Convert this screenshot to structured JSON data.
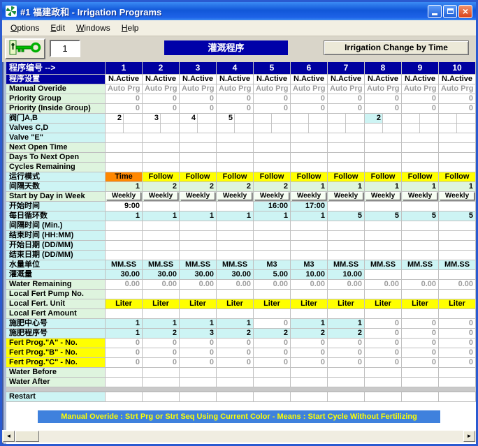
{
  "window": {
    "title": "#1 福建政和 - Irrigation Programs"
  },
  "menu": {
    "items": [
      "Options",
      "Edit",
      "Windows",
      "Help"
    ]
  },
  "toolbar": {
    "program_number": "1",
    "banner": "灌溉程序",
    "change_by_time_button": "Irrigation Change by Time"
  },
  "table": {
    "header_label": "程序编号 -->",
    "columns": [
      "1",
      "2",
      "3",
      "4",
      "5",
      "6",
      "7",
      "8",
      "9",
      "10"
    ],
    "rows": [
      {
        "name": "program-settings",
        "label": "程序设置",
        "label_bg": "navy",
        "values": "N.Active",
        "align": "center"
      },
      {
        "name": "manual-override",
        "label": "Manual Overide",
        "label_bg": "green",
        "values": "Auto Prg",
        "cell_fg": "gray",
        "align": "center"
      },
      {
        "name": "priority-group",
        "label": "Priority Group",
        "label_bg": "green",
        "values": "0",
        "cell_fg": "gray"
      },
      {
        "name": "priority-inside-group",
        "label": "Priority (Inside Group)",
        "label_bg": "green",
        "values": "0",
        "cell_fg": "gray"
      },
      {
        "name": "valves-a-b",
        "label": "阀门A,B",
        "label_bg": "cyan",
        "split": true,
        "values": [
          "2",
          "3",
          "4",
          "5",
          "",
          "",
          "",
          "2",
          "",
          ""
        ],
        "cell_bgs": [
          "white",
          "white",
          "white",
          "white",
          "white",
          "white",
          "white",
          "cyan",
          "white",
          "white"
        ]
      },
      {
        "name": "valves-c-d",
        "label": "Valves C,D",
        "label_bg": "cyan",
        "split": true,
        "values": ""
      },
      {
        "name": "valve-e",
        "label": "Valve \"E\"",
        "label_bg": "cyan",
        "values": ""
      },
      {
        "name": "next-open-time",
        "label": "Next  Open Time",
        "label_bg": "green",
        "values": ""
      },
      {
        "name": "days-to-next-open",
        "label": "Days To Next Open",
        "label_bg": "green",
        "values": ""
      },
      {
        "name": "cycles-remaining",
        "label": "Cycles Remaining",
        "label_bg": "green",
        "values": ""
      },
      {
        "name": "run-mode",
        "label": "运行模式",
        "label_bg": "cyan",
        "values": [
          "Time",
          "Follow",
          "Follow",
          "Follow",
          "Follow",
          "Follow",
          "Follow",
          "Follow",
          "Follow",
          "Follow"
        ],
        "cell_bgs": [
          "orange",
          "yellow",
          "yellow",
          "yellow",
          "yellow",
          "yellow",
          "yellow",
          "yellow",
          "yellow",
          "yellow"
        ],
        "align": "center"
      },
      {
        "name": "interval-days",
        "label": "间隔天数",
        "label_bg": "cyan",
        "values": [
          "1",
          "2",
          "2",
          "2",
          "2",
          "1",
          "1",
          "1",
          "1",
          "1"
        ],
        "cell_bg": "green"
      },
      {
        "name": "start-by-day-in-week",
        "label": "Start by Day in Week",
        "label_bg": "green",
        "widget": "button",
        "values": "Weekly",
        "cell_bg": "green"
      },
      {
        "name": "start-time",
        "label": "开始时间",
        "label_bg": "cyan",
        "values": [
          "9:00",
          "",
          "",
          "",
          "16:00",
          "17:00",
          "",
          "",
          "",
          ""
        ],
        "cell_bgs": [
          "white",
          "white",
          "white",
          "white",
          "cyan",
          "cyan",
          "white",
          "white",
          "white",
          "white"
        ]
      },
      {
        "name": "daily-cycles",
        "label": "每日循环数",
        "label_bg": "cyan",
        "values": [
          "1",
          "1",
          "1",
          "1",
          "1",
          "1",
          "5",
          "5",
          "5",
          "5"
        ],
        "cell_bg": "cyan"
      },
      {
        "name": "interval-time-min",
        "label": "间隔时间 (Min.)",
        "label_bg": "cyan",
        "values": ""
      },
      {
        "name": "end-time-hhmm",
        "label": "结束时间 (HH:MM)",
        "label_bg": "cyan",
        "values": ""
      },
      {
        "name": "start-date-ddmm",
        "label": "开始日期 (DD/MM)",
        "label_bg": "cyan",
        "values": ""
      },
      {
        "name": "end-date-ddmm",
        "label": "结束日期 (DD/MM)",
        "label_bg": "cyan",
        "values": ""
      },
      {
        "name": "water-unit",
        "label": "水量单位",
        "label_bg": "cyan",
        "values": [
          "MM.SS",
          "MM.SS",
          "MM.SS",
          "MM.SS",
          "M3",
          "M3",
          "MM.SS",
          "MM.SS",
          "MM.SS",
          "MM.SS"
        ],
        "cell_bg": "cyan",
        "align": "center"
      },
      {
        "name": "irrigation-amount",
        "label": "灌溉量",
        "label_bg": "cyan",
        "values": [
          "30.00",
          "30.00",
          "30.00",
          "30.00",
          "5.00",
          "10.00",
          "10.00",
          "",
          "",
          ""
        ],
        "cell_bgs": [
          "cyan",
          "cyan",
          "cyan",
          "cyan",
          "cyan",
          "cyan",
          "cyan",
          "white",
          "white",
          "white"
        ]
      },
      {
        "name": "water-remaining",
        "label": "Water Remaining",
        "label_bg": "green",
        "values": "0.00",
        "cell_fg": "gray"
      },
      {
        "name": "local-fert-pump-no",
        "label": "Local Fert Pump No.",
        "label_bg": "green",
        "values": ""
      },
      {
        "name": "local-fert-unit",
        "label": "Local Fert. Unit",
        "label_bg": "green",
        "values": "Liter",
        "cell_bg": "yellow",
        "align": "center"
      },
      {
        "name": "local-fert-amount",
        "label": "Local Fert Amount",
        "label_bg": "green",
        "values": ""
      },
      {
        "name": "fert-center-no",
        "label": "施肥中心号",
        "label_bg": "cyan",
        "values": [
          "1",
          "1",
          "1",
          "1",
          "0",
          "1",
          "1",
          "0",
          "0",
          "0"
        ],
        "cell_bgs": [
          "cyan",
          "cyan",
          "cyan",
          "cyan",
          "white",
          "cyan",
          "cyan",
          "white",
          "white",
          "white"
        ],
        "cell_fgs": [
          "black",
          "black",
          "black",
          "black",
          "gray",
          "black",
          "black",
          "gray",
          "gray",
          "gray"
        ]
      },
      {
        "name": "fert-program-no",
        "label": "施肥程序号",
        "label_bg": "cyan",
        "values": [
          "1",
          "2",
          "3",
          "2",
          "2",
          "2",
          "2",
          "0",
          "0",
          "0"
        ],
        "cell_bgs": [
          "cyan",
          "cyan",
          "cyan",
          "cyan",
          "cyan",
          "cyan",
          "cyan",
          "white",
          "white",
          "white"
        ],
        "cell_fgs": [
          "black",
          "black",
          "black",
          "black",
          "black",
          "black",
          "black",
          "gray",
          "gray",
          "gray"
        ]
      },
      {
        "name": "fert-prog-a-no",
        "label": "Fert Prog.\"A\" - No.",
        "label_bg": "yellow",
        "values": "0",
        "cell_fg": "gray"
      },
      {
        "name": "fert-prog-b-no",
        "label": "Fert Prog.\"B\" - No.",
        "label_bg": "yellow",
        "values": "0",
        "cell_fg": "gray"
      },
      {
        "name": "fert-prog-c-no",
        "label": "Fert Prog.\"C\" - No.",
        "label_bg": "yellow",
        "values": "0",
        "cell_fg": "gray"
      },
      {
        "name": "water-before",
        "label": "Water Before",
        "label_bg": "green",
        "values": ""
      },
      {
        "name": "water-after",
        "label": "Water After",
        "label_bg": "green",
        "values": ""
      },
      {
        "gap": true
      },
      {
        "name": "restart",
        "label": "Restart",
        "label_bg": "cyan",
        "values": ""
      }
    ]
  },
  "status_bar": {
    "text": "Manual Overide : Strt Prg or Strt Seq Using Current Color - Means : Start Cycle Without Fertilizing"
  },
  "colors": {
    "navy": "#0000a0",
    "cyan": "#cdf4f4",
    "green": "#def4de",
    "yellow": "#ffff00",
    "orange": "#ff8700",
    "white": "#ffffff",
    "gray": "#9c9c9c",
    "black": "#000000",
    "status_blue": "#3f81dd",
    "status_text": "#ffff00"
  }
}
